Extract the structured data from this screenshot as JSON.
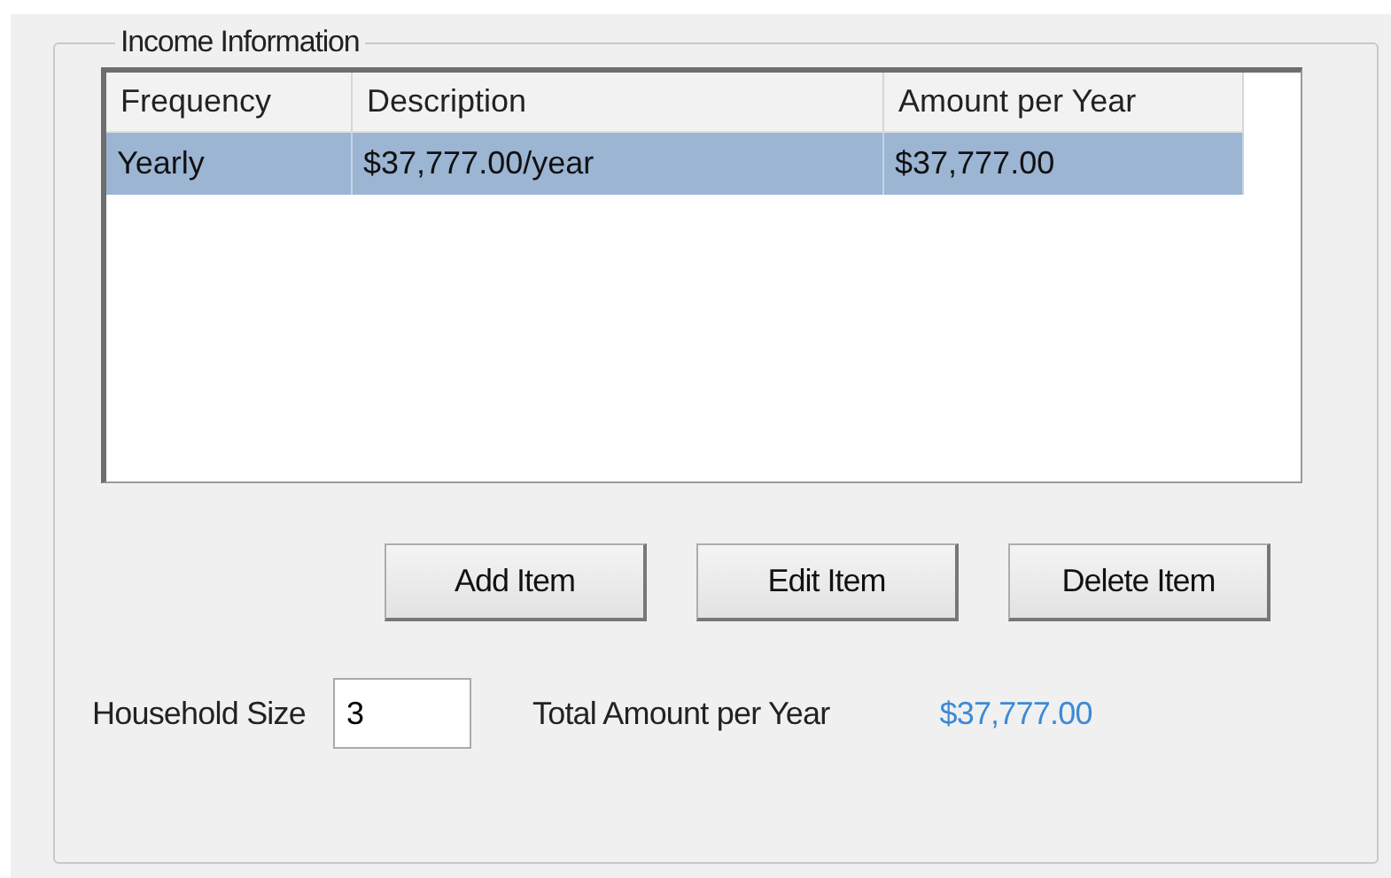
{
  "group": {
    "title": "Income Information"
  },
  "list": {
    "columns": [
      "Frequency",
      "Description",
      "Amount per Year"
    ],
    "rows": [
      {
        "cells": [
          "Yearly",
          "$37,777.00/year",
          "$37,777.00"
        ],
        "selected": true
      }
    ]
  },
  "buttons": [
    "Add Item",
    "Edit Item",
    "Delete Item"
  ],
  "household_size": {
    "label": "Household Size",
    "value": "3"
  },
  "total": {
    "label": "Total Amount per Year",
    "value": "$37,777.00"
  }
}
